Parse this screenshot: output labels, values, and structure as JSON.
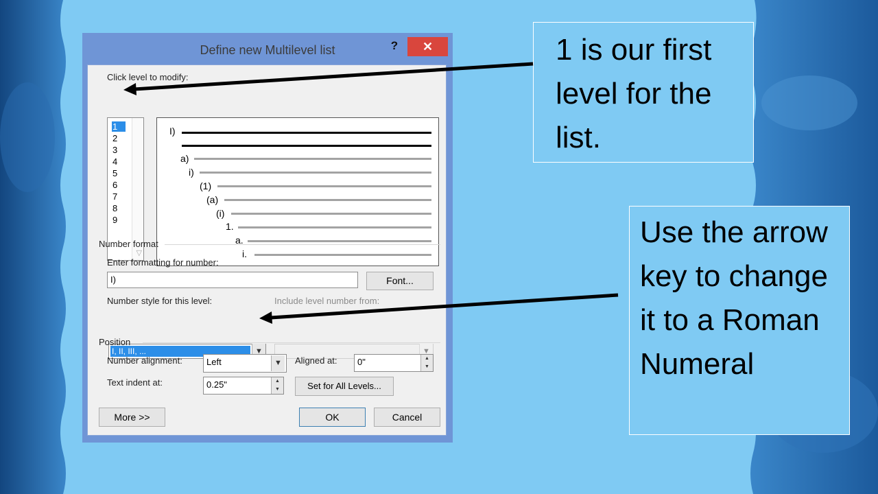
{
  "dialog": {
    "title": "Define new Multilevel list",
    "help_label": "?",
    "close_label": "✕",
    "click_level_label": "Click level to modify:",
    "levels": [
      "1",
      "2",
      "3",
      "4",
      "5",
      "6",
      "7",
      "8",
      "9"
    ],
    "preview_labels": [
      "I)",
      "a)",
      "i)",
      "(1)",
      "(a)",
      "(i)",
      "1.",
      "a.",
      "i."
    ],
    "number_format_heading": "Number format",
    "enter_formatting_label": "Enter formatting for number:",
    "formatting_value": "I)",
    "font_button": "Font...",
    "number_style_label": "Number style for this level:",
    "number_style_value": "I, II, III, ...",
    "include_level_label": "Include level number from:",
    "position_heading": "Position",
    "number_alignment_label": "Number alignment:",
    "number_alignment_value": "Left",
    "aligned_at_label": "Aligned at:",
    "aligned_at_value": "0\"",
    "text_indent_label": "Text indent at:",
    "text_indent_value": "0.25\"",
    "set_all_levels_button": "Set for All Levels...",
    "more_button": "More >>",
    "ok_button": "OK",
    "cancel_button": "Cancel"
  },
  "callouts": {
    "first": "1 is our first level for the list.",
    "second": "Use the arrow key to change it to a Roman Numeral"
  },
  "colors": {
    "background": "#7fcaf3",
    "dialog_frame": "#6f95d6",
    "close_red": "#d9463d",
    "selection_blue": "#2c8ee8",
    "wave_dark": "#1f5ea8"
  }
}
